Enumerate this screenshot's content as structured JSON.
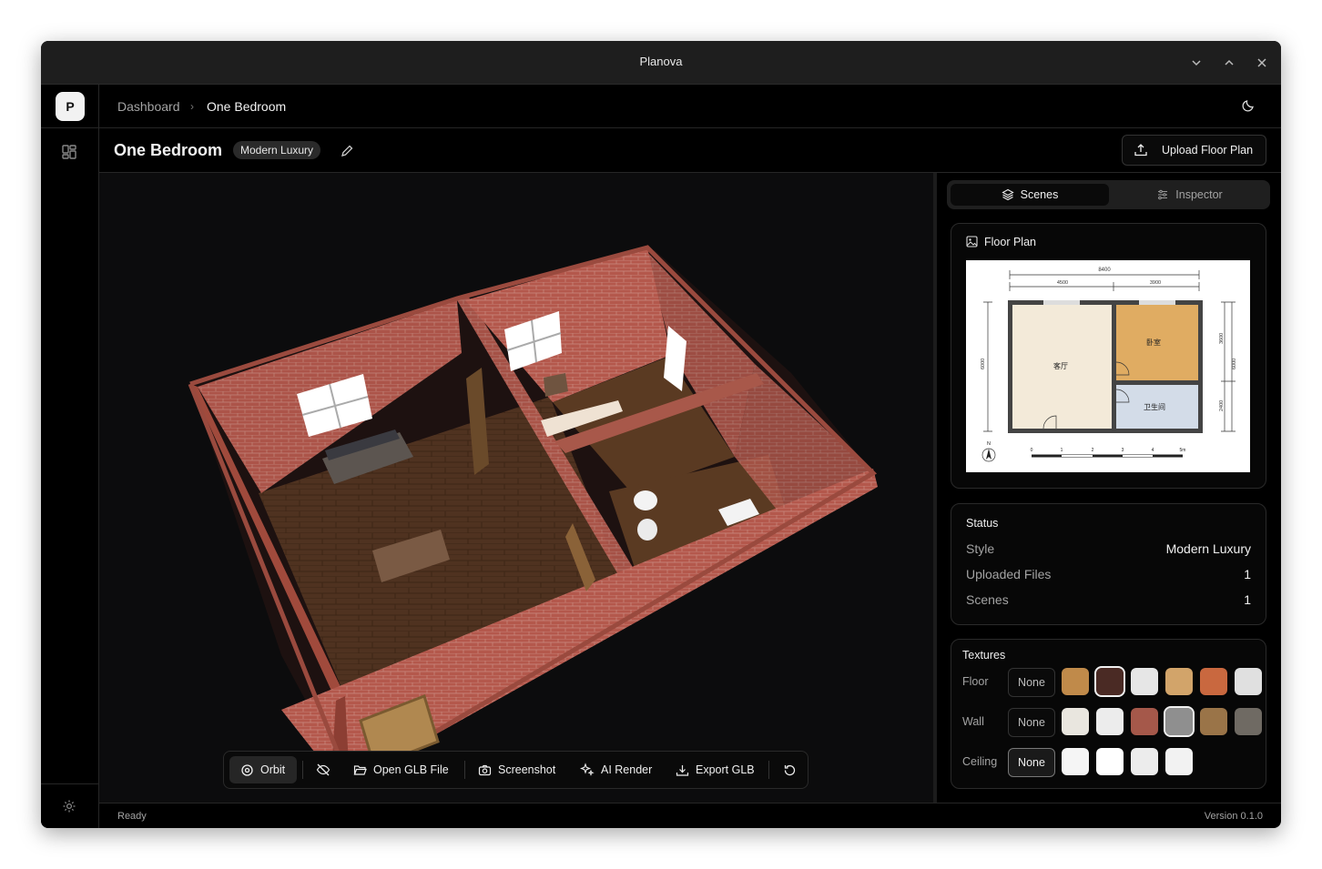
{
  "window": {
    "title": "Planova"
  },
  "rail": {
    "logo": "P",
    "icons": [
      "dashboard-icon",
      "settings-icon"
    ]
  },
  "breadcrumb": {
    "root": "Dashboard",
    "current": "One Bedroom"
  },
  "header": {
    "title": "One Bedroom",
    "style_badge": "Modern Luxury",
    "upload_label": "Upload Floor Plan"
  },
  "toolbar": {
    "orbit": "Orbit",
    "open_glb": "Open GLB File",
    "screenshot": "Screenshot",
    "ai_render": "AI Render",
    "export_glb": "Export GLB"
  },
  "tabs": {
    "scenes": "Scenes",
    "inspector": "Inspector",
    "active": "Scenes"
  },
  "floor_plan": {
    "title": "Floor Plan",
    "total_width": "8400",
    "left_width": "4500",
    "right_width": "3900",
    "depth": "6000",
    "right_top": "3600",
    "right_bottom": "2400",
    "rooms": {
      "living": "客厅",
      "bedroom": "卧室",
      "bathroom": "卫生间"
    },
    "north": "N",
    "scale_ticks": [
      "0",
      "1",
      "2",
      "3",
      "4",
      "5m"
    ]
  },
  "status": {
    "title": "Status",
    "rows": [
      {
        "label": "Style",
        "value": "Modern Luxury"
      },
      {
        "label": "Uploaded Files",
        "value": "1"
      },
      {
        "label": "Scenes",
        "value": "1"
      }
    ]
  },
  "textures": {
    "title": "Textures",
    "none_label": "None",
    "floor": {
      "label": "Floor",
      "swatches": [
        "#c08a4a",
        "#4a2a24",
        "#e6e6e6",
        "#d2a46a",
        "#c9683f",
        "#e0e0e0"
      ],
      "selected": 1
    },
    "wall": {
      "label": "Wall",
      "swatches": [
        "#e9e6df",
        "#ececec",
        "#a5584a",
        "#8f8f8f",
        "#9a7448",
        "#6f6a63"
      ],
      "selected": 3
    },
    "ceiling": {
      "label": "Ceiling",
      "swatches": [
        "#f5f5f5",
        "#ffffff",
        "#ececec",
        "#f2f2f2"
      ],
      "selected": 0
    }
  },
  "statusbar": {
    "left": "Ready",
    "right": "Version 0.1.0"
  }
}
